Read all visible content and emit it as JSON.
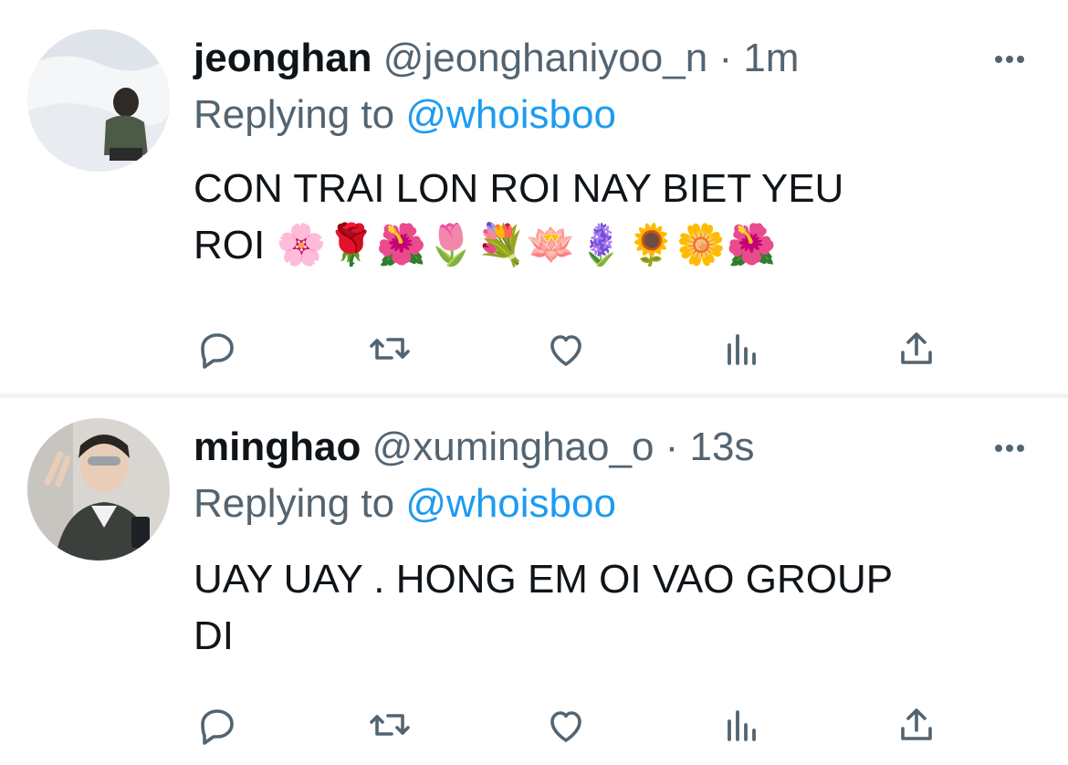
{
  "tweets": [
    {
      "name": "jeonghan",
      "handle": "@jeonghaniyoo_n",
      "separator": "·",
      "time": "1m",
      "replying_label": "Replying to",
      "replying_to": "@whoisboo",
      "text_line1": "CON TRAI LON ROI NAY BIET YEU",
      "text_line2": "ROI 🌸🌹🌺🌷💐🪷🪻🌻🌼🌺"
    },
    {
      "name": "minghao",
      "handle": "@xuminghao_o",
      "separator": "·",
      "time": "13s",
      "replying_label": "Replying to",
      "replying_to": "@whoisboo",
      "text_line1": "UAY UAY . HONG EM OI VAO GROUP",
      "text_line2": "DI"
    }
  ],
  "icons": {
    "reply": "reply-icon",
    "retweet": "retweet-icon",
    "like": "heart-icon",
    "views": "views-icon",
    "share": "share-icon",
    "more": "more-icon"
  },
  "colors": {
    "text": "#0f1419",
    "secondary": "#536471",
    "link": "#1d9bf0",
    "divider": "#eff3f4"
  }
}
